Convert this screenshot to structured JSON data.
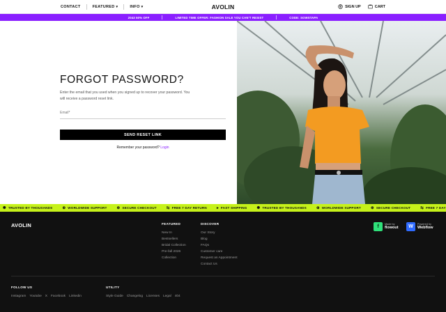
{
  "nav": {
    "contact": "CONTACT",
    "featured": "FEATURED",
    "info": "INFO",
    "brand": "AVOLIN",
    "sign_up": "SIGN UP",
    "cart": "CART"
  },
  "promo": {
    "items": [
      "2043 50% OFF",
      "LIMITED TIME OFFER: FASHION SALE YOU CAN'T RESIST",
      "CODE: SOWSTAPA"
    ]
  },
  "form": {
    "title": "FORGOT PASSWORD?",
    "description": "Enter the email that you used when you signed up to recover your password. You will receive a password reset link.",
    "email_label": "Email*",
    "email_value": "",
    "submit_label": "SEND RESET LINK",
    "remember_text": "Remember your password?",
    "login_link": "Login"
  },
  "photo": {
    "icon": "woman-portrait-photo"
  },
  "ticker": {
    "items": [
      "TRUSTED BY THOUSANDS",
      "WORLDWIDE SUPPORT",
      "SECURE CHECKOUT",
      "FREE 7 DAY RETURN",
      "FAST SHIPPING",
      "TRUSTED BY THOUSANDS",
      "WORLDWIDE SUPPORT",
      "SECURE CHECKOUT",
      "FREE 7 DAY"
    ]
  },
  "footer": {
    "brand": "AVOLIN",
    "featured": {
      "title": "FEATURED",
      "links": [
        "New In",
        "Bestsellers",
        "Bridal Collection",
        "Pre-fall 2026",
        "Collection"
      ]
    },
    "discover": {
      "title": "DISCOVER",
      "links": [
        "Our Story",
        "Blog",
        "FAQs",
        "Customer care",
        "Request an Appointment",
        "Contact Us"
      ]
    },
    "badges": {
      "flowout_small": "Made by",
      "flowout_name": "flowout",
      "webflow_small": "Powered by",
      "webflow_name": "Webflow"
    },
    "follow": {
      "title": "FOLLOW US",
      "links": [
        "Instagram",
        "Youtube",
        "X",
        "Facebook",
        "Linkedin"
      ]
    },
    "utility": {
      "title": "UTILITY",
      "links": [
        "Style Guide",
        "Changelog",
        "Licenses",
        "Legal",
        "404"
      ]
    }
  },
  "colors": {
    "promo": "#8a1fff",
    "ticker": "#c6f21a",
    "footer": "#111111",
    "link_accent": "#8a1fff"
  }
}
